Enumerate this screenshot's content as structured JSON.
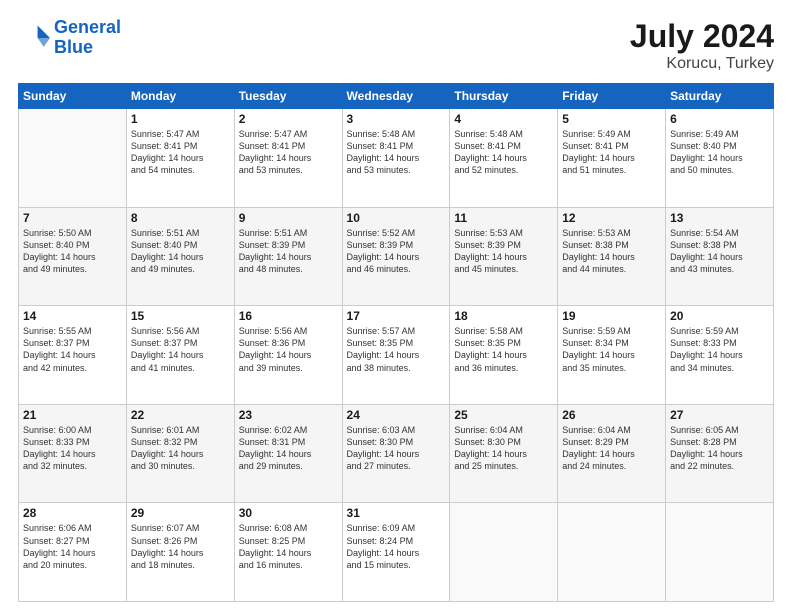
{
  "logo": {
    "line1": "General",
    "line2": "Blue"
  },
  "header": {
    "month_year": "July 2024",
    "location": "Korucu, Turkey"
  },
  "days_of_week": [
    "Sunday",
    "Monday",
    "Tuesday",
    "Wednesday",
    "Thursday",
    "Friday",
    "Saturday"
  ],
  "weeks": [
    [
      {
        "day": "",
        "info": ""
      },
      {
        "day": "1",
        "info": "Sunrise: 5:47 AM\nSunset: 8:41 PM\nDaylight: 14 hours\nand 54 minutes."
      },
      {
        "day": "2",
        "info": "Sunrise: 5:47 AM\nSunset: 8:41 PM\nDaylight: 14 hours\nand 53 minutes."
      },
      {
        "day": "3",
        "info": "Sunrise: 5:48 AM\nSunset: 8:41 PM\nDaylight: 14 hours\nand 53 minutes."
      },
      {
        "day": "4",
        "info": "Sunrise: 5:48 AM\nSunset: 8:41 PM\nDaylight: 14 hours\nand 52 minutes."
      },
      {
        "day": "5",
        "info": "Sunrise: 5:49 AM\nSunset: 8:41 PM\nDaylight: 14 hours\nand 51 minutes."
      },
      {
        "day": "6",
        "info": "Sunrise: 5:49 AM\nSunset: 8:40 PM\nDaylight: 14 hours\nand 50 minutes."
      }
    ],
    [
      {
        "day": "7",
        "info": "Sunrise: 5:50 AM\nSunset: 8:40 PM\nDaylight: 14 hours\nand 49 minutes."
      },
      {
        "day": "8",
        "info": "Sunrise: 5:51 AM\nSunset: 8:40 PM\nDaylight: 14 hours\nand 49 minutes."
      },
      {
        "day": "9",
        "info": "Sunrise: 5:51 AM\nSunset: 8:39 PM\nDaylight: 14 hours\nand 48 minutes."
      },
      {
        "day": "10",
        "info": "Sunrise: 5:52 AM\nSunset: 8:39 PM\nDaylight: 14 hours\nand 46 minutes."
      },
      {
        "day": "11",
        "info": "Sunrise: 5:53 AM\nSunset: 8:39 PM\nDaylight: 14 hours\nand 45 minutes."
      },
      {
        "day": "12",
        "info": "Sunrise: 5:53 AM\nSunset: 8:38 PM\nDaylight: 14 hours\nand 44 minutes."
      },
      {
        "day": "13",
        "info": "Sunrise: 5:54 AM\nSunset: 8:38 PM\nDaylight: 14 hours\nand 43 minutes."
      }
    ],
    [
      {
        "day": "14",
        "info": "Sunrise: 5:55 AM\nSunset: 8:37 PM\nDaylight: 14 hours\nand 42 minutes."
      },
      {
        "day": "15",
        "info": "Sunrise: 5:56 AM\nSunset: 8:37 PM\nDaylight: 14 hours\nand 41 minutes."
      },
      {
        "day": "16",
        "info": "Sunrise: 5:56 AM\nSunset: 8:36 PM\nDaylight: 14 hours\nand 39 minutes."
      },
      {
        "day": "17",
        "info": "Sunrise: 5:57 AM\nSunset: 8:35 PM\nDaylight: 14 hours\nand 38 minutes."
      },
      {
        "day": "18",
        "info": "Sunrise: 5:58 AM\nSunset: 8:35 PM\nDaylight: 14 hours\nand 36 minutes."
      },
      {
        "day": "19",
        "info": "Sunrise: 5:59 AM\nSunset: 8:34 PM\nDaylight: 14 hours\nand 35 minutes."
      },
      {
        "day": "20",
        "info": "Sunrise: 5:59 AM\nSunset: 8:33 PM\nDaylight: 14 hours\nand 34 minutes."
      }
    ],
    [
      {
        "day": "21",
        "info": "Sunrise: 6:00 AM\nSunset: 8:33 PM\nDaylight: 14 hours\nand 32 minutes."
      },
      {
        "day": "22",
        "info": "Sunrise: 6:01 AM\nSunset: 8:32 PM\nDaylight: 14 hours\nand 30 minutes."
      },
      {
        "day": "23",
        "info": "Sunrise: 6:02 AM\nSunset: 8:31 PM\nDaylight: 14 hours\nand 29 minutes."
      },
      {
        "day": "24",
        "info": "Sunrise: 6:03 AM\nSunset: 8:30 PM\nDaylight: 14 hours\nand 27 minutes."
      },
      {
        "day": "25",
        "info": "Sunrise: 6:04 AM\nSunset: 8:30 PM\nDaylight: 14 hours\nand 25 minutes."
      },
      {
        "day": "26",
        "info": "Sunrise: 6:04 AM\nSunset: 8:29 PM\nDaylight: 14 hours\nand 24 minutes."
      },
      {
        "day": "27",
        "info": "Sunrise: 6:05 AM\nSunset: 8:28 PM\nDaylight: 14 hours\nand 22 minutes."
      }
    ],
    [
      {
        "day": "28",
        "info": "Sunrise: 6:06 AM\nSunset: 8:27 PM\nDaylight: 14 hours\nand 20 minutes."
      },
      {
        "day": "29",
        "info": "Sunrise: 6:07 AM\nSunset: 8:26 PM\nDaylight: 14 hours\nand 18 minutes."
      },
      {
        "day": "30",
        "info": "Sunrise: 6:08 AM\nSunset: 8:25 PM\nDaylight: 14 hours\nand 16 minutes."
      },
      {
        "day": "31",
        "info": "Sunrise: 6:09 AM\nSunset: 8:24 PM\nDaylight: 14 hours\nand 15 minutes."
      },
      {
        "day": "",
        "info": ""
      },
      {
        "day": "",
        "info": ""
      },
      {
        "day": "",
        "info": ""
      }
    ]
  ]
}
